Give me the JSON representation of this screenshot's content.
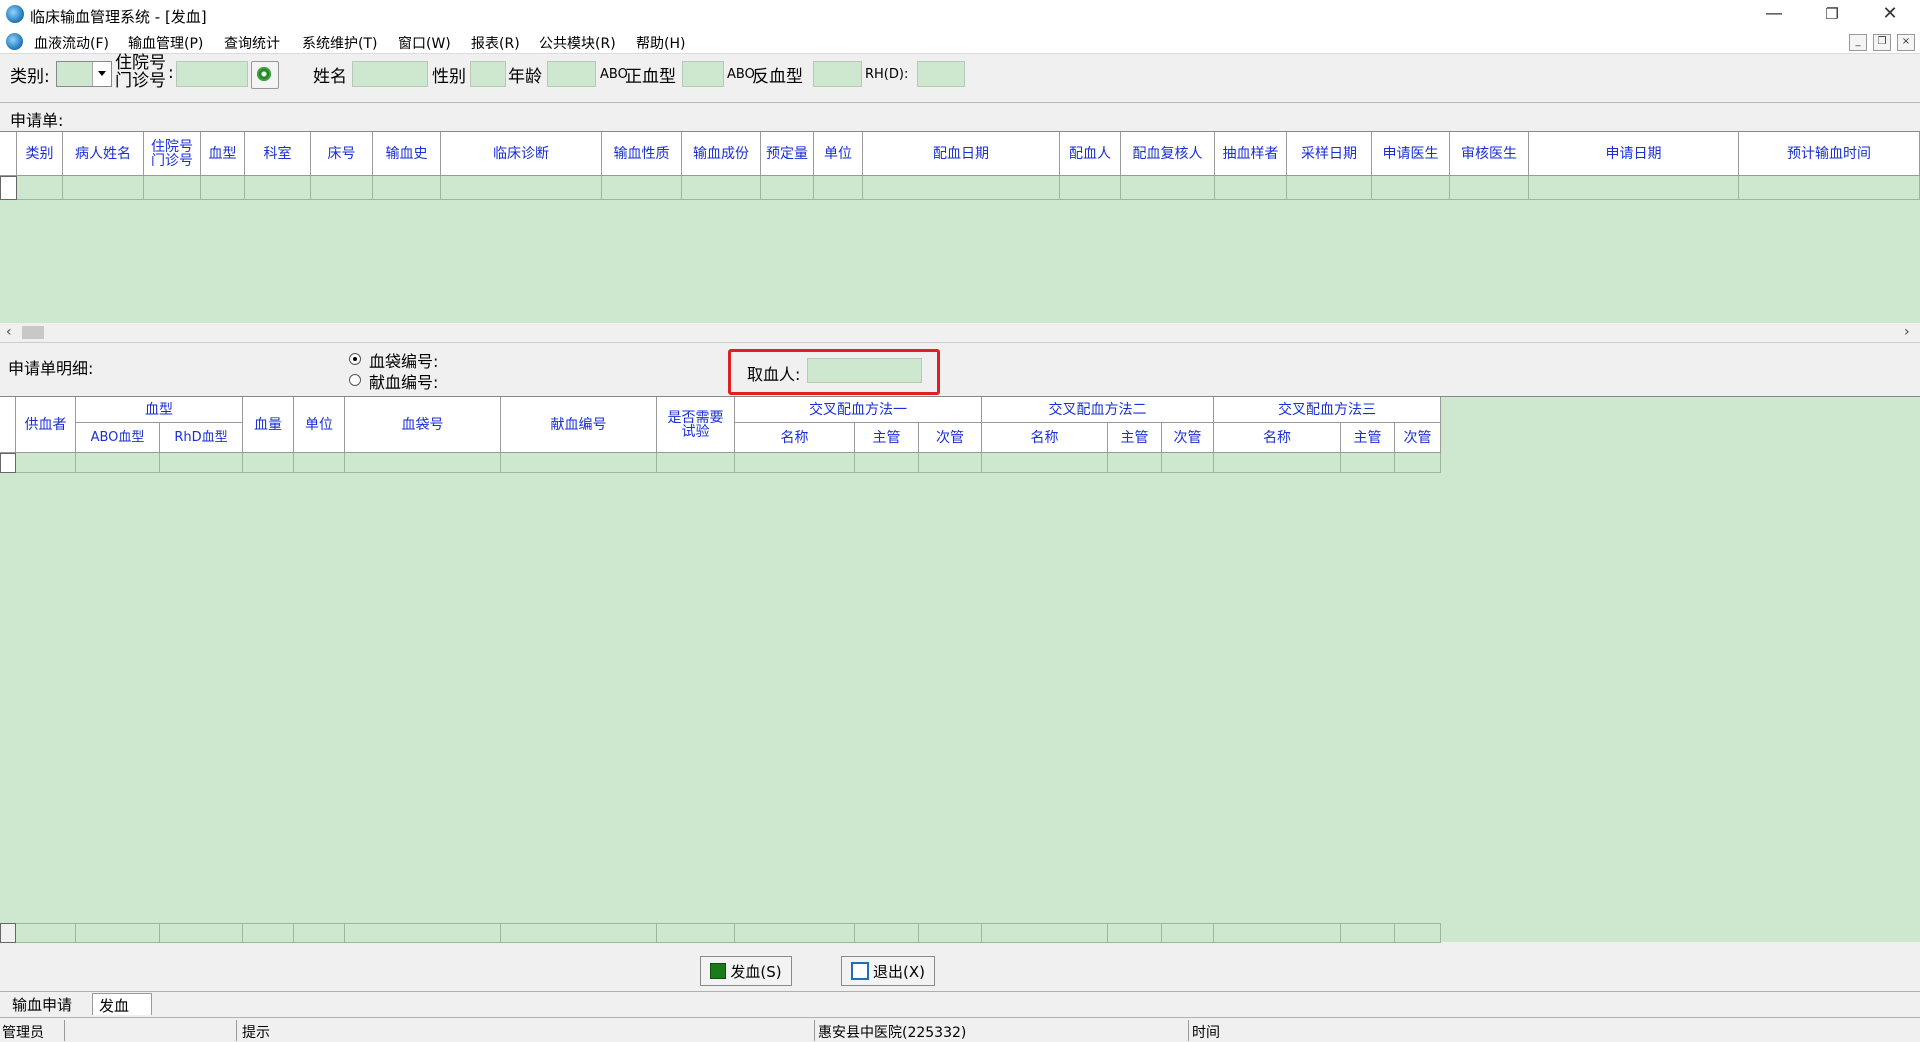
{
  "window": {
    "title": "临床输血管理系统 - [发血]",
    "minimize": "—",
    "restore": "❐",
    "close": "✕"
  },
  "menu": [
    "血液流动(F)",
    "输血管理(P)",
    "查询统计",
    "系统维护(T)",
    "窗口(W)",
    "报表(R)",
    "公共模块(R)",
    "帮助(H)"
  ],
  "mdi": {
    "min": "_",
    "restore": "❐",
    "close": "×"
  },
  "form": {
    "category_label": "类别:",
    "inpatient_label_1": "住院号",
    "inpatient_label_2": "门诊号",
    "name_label": "姓名",
    "sex_label": "性别",
    "age_label": "年龄",
    "abo_pos_prefix": "ABO",
    "abo_pos_label": "正血型",
    "abo_neg_prefix": "ABO",
    "abo_neg_label": "反血型",
    "rh_label": "RH(D):"
  },
  "request_section": {
    "title": "申请单:",
    "columns": [
      "类别",
      "病人姓名",
      "住院号门诊号",
      "血型",
      "科室",
      "床号",
      "输血史",
      "临床诊断",
      "输血性质",
      "输血成份",
      "预定量",
      "单位",
      "配血日期",
      "配血人",
      "配血复核人",
      "抽血样者",
      "采样日期",
      "申请医生",
      "审核医生",
      "申请日期",
      "预计输血时间"
    ]
  },
  "detail_section": {
    "title": "申请单明细:",
    "radio_bag": "血袋编号:",
    "radio_donor": "献血编号:",
    "taker_label": "取血人:",
    "columns": {
      "donor": "供血者",
      "blood_type": "血型",
      "abo": "ABO血型",
      "rhd": "RhD血型",
      "volume": "血量",
      "unit": "单位",
      "bag_no": "血袋号",
      "donation_no": "献血编号",
      "need_test_1": "是否需要",
      "need_test_2": "试验",
      "cross1": "交叉配血方法一",
      "cross2": "交叉配血方法二",
      "cross3": "交叉配血方法三",
      "name": "名称",
      "major": "主管",
      "minor": "次管"
    }
  },
  "buttons": {
    "issue": "发血(S)",
    "exit": "退出(X)"
  },
  "tabs": [
    "输血申请",
    "发血"
  ],
  "status": {
    "user": "管理员",
    "hint": "提示",
    "hospital": "惠安县中医院(225332)",
    "time": "时间"
  },
  "colors": {
    "grid_bg": "#cde8cf",
    "header_text": "#1a2fd6",
    "highlight": "#e02020"
  }
}
